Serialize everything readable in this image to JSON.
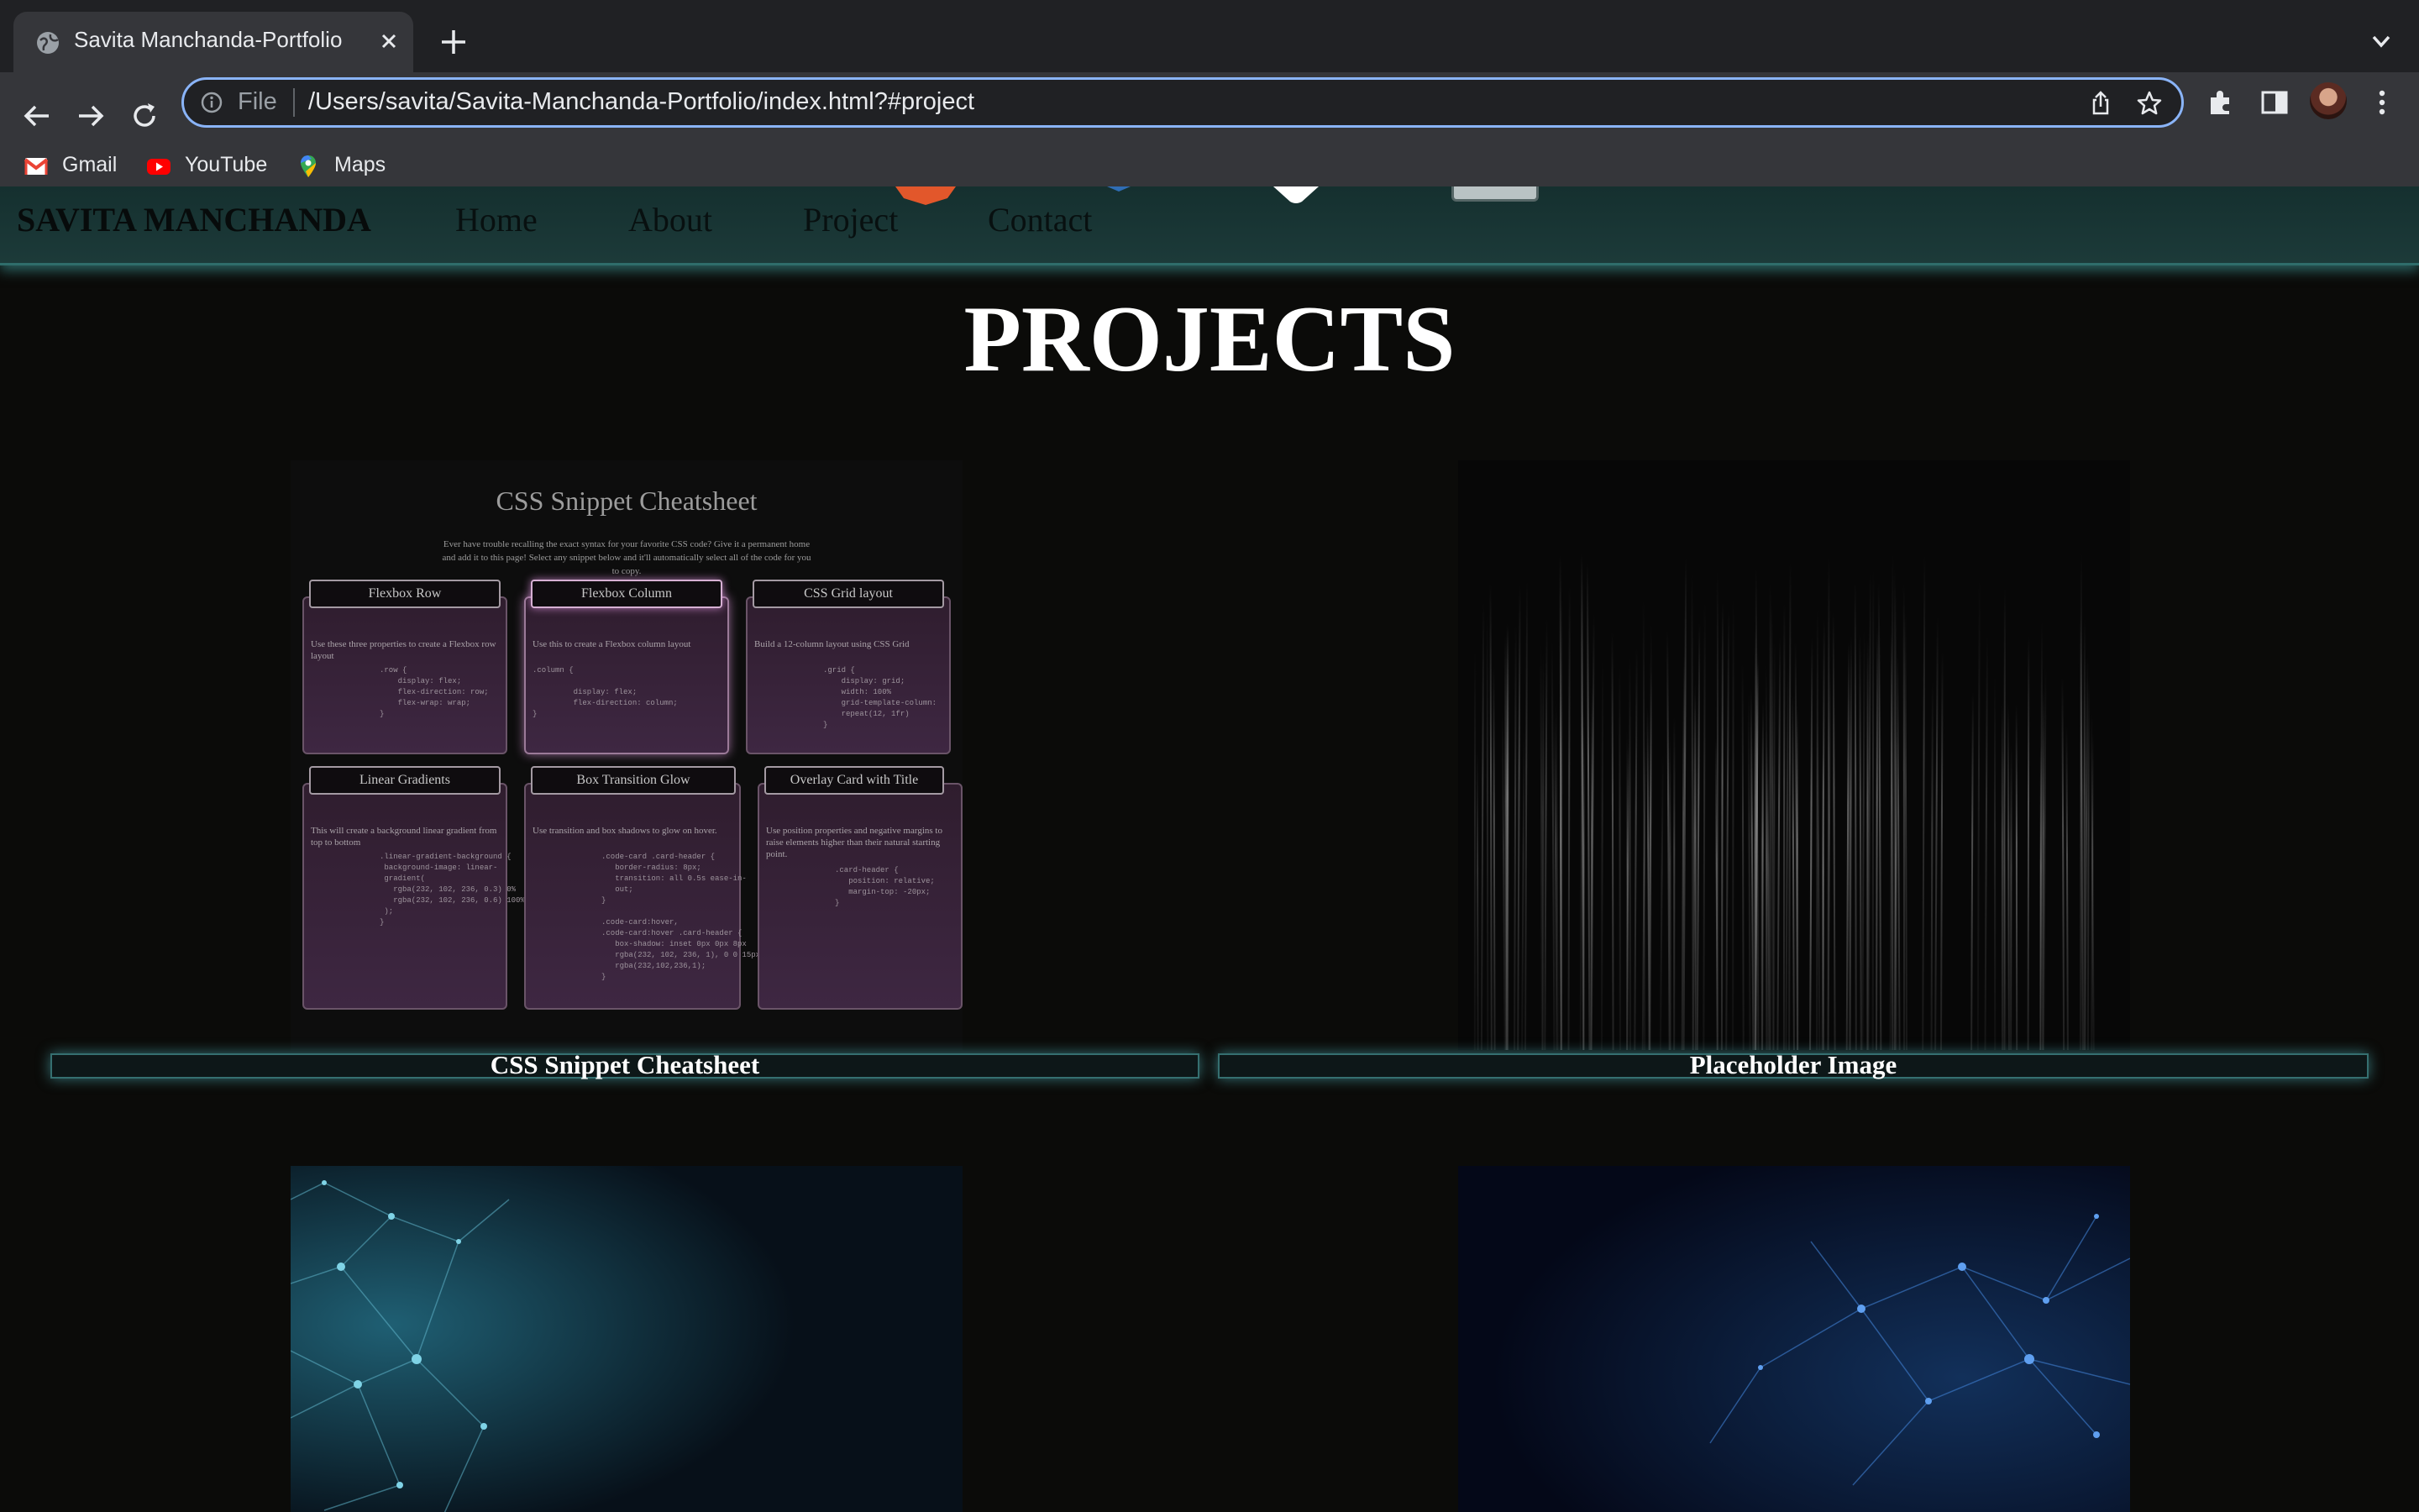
{
  "browser": {
    "tab_title": "Savita Manchanda-Portfolio",
    "scheme_label": "File",
    "url": "/Users/savita/Savita-Manchanda-Portfolio/index.html?#project",
    "bookmarks": [
      {
        "label": "Gmail",
        "icon": "gmail-icon"
      },
      {
        "label": "YouTube",
        "icon": "youtube-icon"
      },
      {
        "label": "Maps",
        "icon": "maps-icon"
      }
    ]
  },
  "site": {
    "brand": "SAVITA MANCHANDA",
    "nav": [
      "Home",
      "About",
      "Project",
      "Contact"
    ],
    "section_title": "PROJECTS",
    "projects": [
      {
        "caption": "CSS Snippet Cheatsheet"
      },
      {
        "caption": "Placeholder Image"
      }
    ]
  },
  "cheatsheet": {
    "title": "CSS Snippet Cheatsheet",
    "intro": "Ever have trouble recalling the exact syntax for your favorite CSS code? Give it a permanent home and add it to this page! Select any snippet below and it'll automatically select all of the code for you to copy.",
    "cards": [
      {
        "title": "Flexbox Row",
        "desc": "Use these three properties to create a Flexbox row layout",
        "code": ".row {\n    display: flex;\n    flex-direction: row;\n    flex-wrap: wrap;\n}"
      },
      {
        "title": "Flexbox Column",
        "desc": "Use this to create a Flexbox column layout",
        "code": ".column {\n\n         display: flex;\n         flex-direction: column;\n}"
      },
      {
        "title": "CSS Grid layout",
        "desc": "Build a 12-column layout using CSS Grid",
        "code": ".grid {\n    display: grid;\n    width: 100%\n    grid-template-column:\n    repeat(12, 1fr)\n}"
      },
      {
        "title": "Linear Gradients",
        "desc": "This will create a background linear gradient from top to bottom",
        "code": ".linear-gradient-background {\n background-image: linear-\n gradient(\n   rgba(232, 102, 236, 0.3) 0%\n   rgba(232, 102, 236, 0.6) 100%\n );\n}"
      },
      {
        "title": "Box Transition Glow",
        "desc": "Use transition and box shadows to glow on hover.",
        "code": ".code-card .card-header {\n   border-radius: 8px;\n   transition: all 0.5s ease-in-\n   out;\n}\n\n.code-card:hover,\n.code-card:hover .card-header {\n   box-shadow: inset 0px 0px 8px\n   rgba(232, 102, 236, 1), 0 0 15px\n   rgba(232,102,236,1);\n}"
      },
      {
        "title": "Overlay Card with Title",
        "desc": "Use position properties and negative margins to raise elements higher than their natural starting point.",
        "code": ".card-header {\n   position: relative;\n   margin-top: -20px;\n}"
      }
    ]
  }
}
